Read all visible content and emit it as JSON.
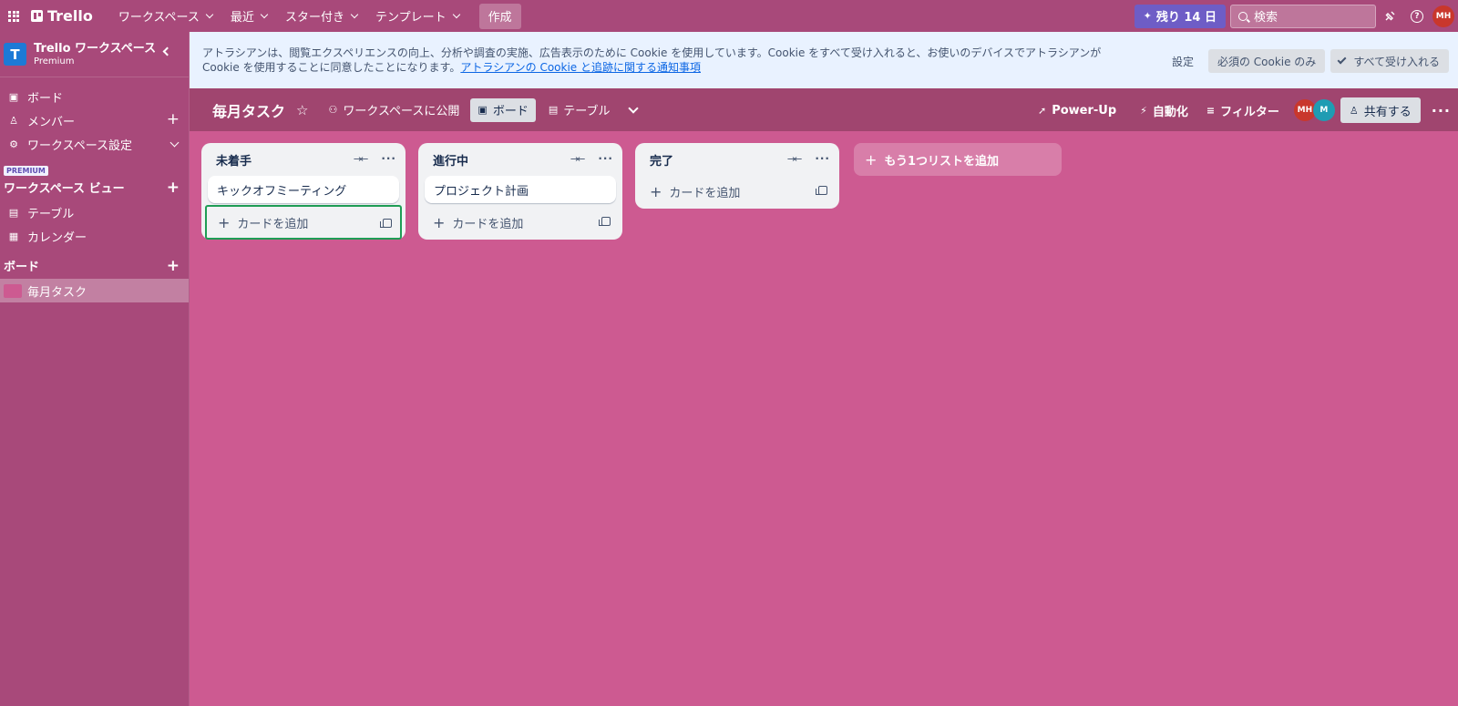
{
  "topnav": {
    "logo": "Trello",
    "menus": [
      {
        "label": "ワークスペース"
      },
      {
        "label": "最近"
      },
      {
        "label": "スター付き"
      },
      {
        "label": "テンプレート"
      }
    ],
    "create_label": "作成",
    "trial_label": "残り 14 日",
    "search_placeholder": "検索",
    "avatar_initials": "MH"
  },
  "sidebar": {
    "workspace_initial": "T",
    "workspace_name": "Trello ワークスペース",
    "workspace_plan": "Premium",
    "items": [
      {
        "label": "ボード",
        "icon": "board-icon"
      },
      {
        "label": "メンバー",
        "icon": "person-icon"
      },
      {
        "label": "ワークスペース設定",
        "icon": "gear-icon"
      }
    ],
    "premium_badge": "PREMIUM",
    "views_title": "ワークスペース ビュー",
    "views": [
      {
        "label": "テーブル",
        "icon": "table-icon"
      },
      {
        "label": "カレンダー",
        "icon": "calendar-icon"
      }
    ],
    "boards_title": "ボード",
    "boards": [
      {
        "label": "毎月タスク",
        "color": "#cd5a91"
      }
    ]
  },
  "cookie_banner": {
    "text": "アトラシアンは、閲覧エクスペリエンスの向上、分析や調査の実施、広告表示のために Cookie を使用しています。Cookie をすべて受け入れると、お使いのデバイスでアトラシアンが Cookie を使用することに同意したことになります。",
    "link": "アトラシアンの Cookie と追跡に関する通知事項",
    "settings_label": "設定",
    "essential_label": "必須の Cookie のみ",
    "accept_all_label": "すべて受け入れる"
  },
  "board_header": {
    "title": "毎月タスク",
    "visibility_label": "ワークスペースに公開",
    "view_board_label": "ボード",
    "view_table_label": "テーブル",
    "powerup_label": "Power-Up",
    "automation_label": "自動化",
    "filter_label": "フィルター",
    "members": [
      {
        "initials": "MH"
      },
      {
        "initials": "M"
      }
    ],
    "share_label": "共有する"
  },
  "lists": [
    {
      "title": "未着手",
      "cards": [
        "キックオフミーティング"
      ],
      "add_card_label": "カードを追加"
    },
    {
      "title": "進行中",
      "cards": [
        "プロジェクト計画"
      ],
      "add_card_label": "カードを追加"
    },
    {
      "title": "完了",
      "cards": [],
      "add_card_label": "カードを追加"
    }
  ],
  "add_list_label": "もう1つリストを追加",
  "colors": {
    "board_background": "#cd5a91",
    "nav_background": "#a8497a",
    "trial_button": "#6e5dc6",
    "focus_outline": "#1f9d55"
  }
}
